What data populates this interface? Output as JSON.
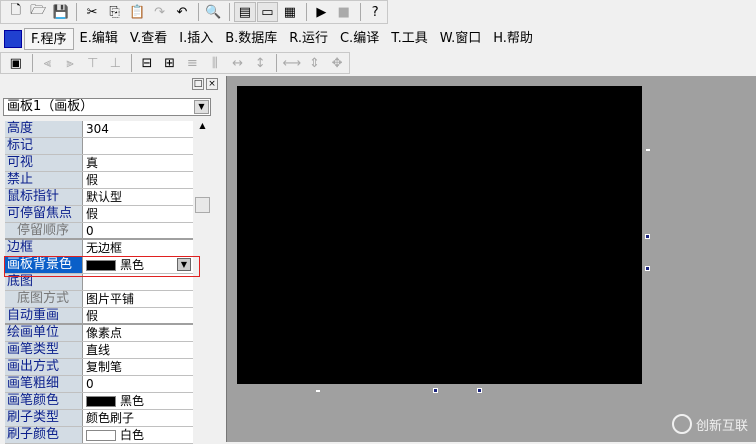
{
  "toolbar": [
    {
      "icon": "new-file-icon",
      "g": "🗋"
    },
    {
      "icon": "open-folder-icon",
      "g": "🗁"
    },
    {
      "icon": "save-icon",
      "g": "💾"
    },
    {
      "sep": true
    },
    {
      "icon": "cut-icon",
      "g": "✂"
    },
    {
      "icon": "copy-icon",
      "g": "⎘"
    },
    {
      "icon": "paste-icon",
      "g": "📋",
      "dis": true
    },
    {
      "icon": "redo-icon",
      "g": "↷",
      "dis": true
    },
    {
      "icon": "undo-icon",
      "g": "↶"
    },
    {
      "sep": true
    },
    {
      "icon": "find-icon",
      "g": "🔍"
    },
    {
      "sep": true
    },
    {
      "icon": "layout1-icon",
      "g": "▤",
      "pressed": true
    },
    {
      "icon": "layout2-icon",
      "g": "▭",
      "pressed": true
    },
    {
      "icon": "layout3-icon",
      "g": "▦"
    },
    {
      "sep": true
    },
    {
      "icon": "run-icon",
      "g": "▶"
    },
    {
      "icon": "stop-icon",
      "g": "■",
      "dis": true
    },
    {
      "sep": true
    },
    {
      "icon": "help-find-icon",
      "g": "?"
    }
  ],
  "menu": [
    "F.程序",
    "E.编辑",
    "V.查看",
    "I.插入",
    "B.数据库",
    "R.运行",
    "C.编译",
    "T.工具",
    "W.窗口",
    "H.帮助"
  ],
  "toolbar2": [
    {
      "icon": "form-icon",
      "g": "▣"
    },
    {
      "sep": true
    },
    {
      "icon": "align-left-icon",
      "g": "⫷",
      "dis": true
    },
    {
      "icon": "align-right-icon",
      "g": "⫸",
      "dis": true
    },
    {
      "icon": "align-top-icon",
      "g": "⊤",
      "dis": true
    },
    {
      "icon": "align-bottom-icon",
      "g": "⊥",
      "dis": true
    },
    {
      "sep": true
    },
    {
      "icon": "center-horizontal-icon",
      "g": "⊟"
    },
    {
      "icon": "center-vertical-icon",
      "g": "⊞"
    },
    {
      "icon": "same-width-icon",
      "g": "≡",
      "dis": true
    },
    {
      "icon": "same-height-icon",
      "g": "⫼",
      "dis": true
    },
    {
      "icon": "space-h-icon",
      "g": "↔",
      "dis": true
    },
    {
      "icon": "space-v-icon",
      "g": "↕",
      "dis": true
    },
    {
      "sep": true
    },
    {
      "icon": "width-icon",
      "g": "⟷",
      "dis": true
    },
    {
      "icon": "height-icon",
      "g": "⇕",
      "dis": true
    },
    {
      "icon": "size-icon",
      "g": "✥",
      "dis": true
    }
  ],
  "panel": {
    "object_combo": "画板1（画板）",
    "properties": [
      {
        "k": "高度",
        "v": "304"
      },
      {
        "k": "标记",
        "v": ""
      },
      {
        "k": "可视",
        "v": "真"
      },
      {
        "k": "禁止",
        "v": "假"
      },
      {
        "k": "鼠标指针",
        "v": "默认型"
      },
      {
        "k": "可停留焦点",
        "v": "假"
      },
      {
        "k": "停留顺序",
        "v": "0",
        "sub": true,
        "grp": true
      },
      {
        "k": "边框",
        "v": "无边框"
      },
      {
        "k": "画板背景色",
        "v": "黑色",
        "color": "#000000",
        "sel": true,
        "dd": true
      },
      {
        "k": "底图",
        "v": ""
      },
      {
        "k": "底图方式",
        "v": "图片平铺",
        "sub": true
      },
      {
        "k": "自动重画",
        "v": "假",
        "grp": true
      },
      {
        "k": "绘画单位",
        "v": "像素点"
      },
      {
        "k": "画笔类型",
        "v": "直线"
      },
      {
        "k": "画出方式",
        "v": "复制笔"
      },
      {
        "k": "画笔粗细",
        "v": "0"
      },
      {
        "k": "画笔颜色",
        "v": "黑色",
        "color": "#000000"
      },
      {
        "k": "刷子类型",
        "v": "颜色刷子"
      },
      {
        "k": "刷子颜色",
        "v": "白色",
        "color": "#ffffff"
      }
    ]
  },
  "watermark": "创新互联"
}
